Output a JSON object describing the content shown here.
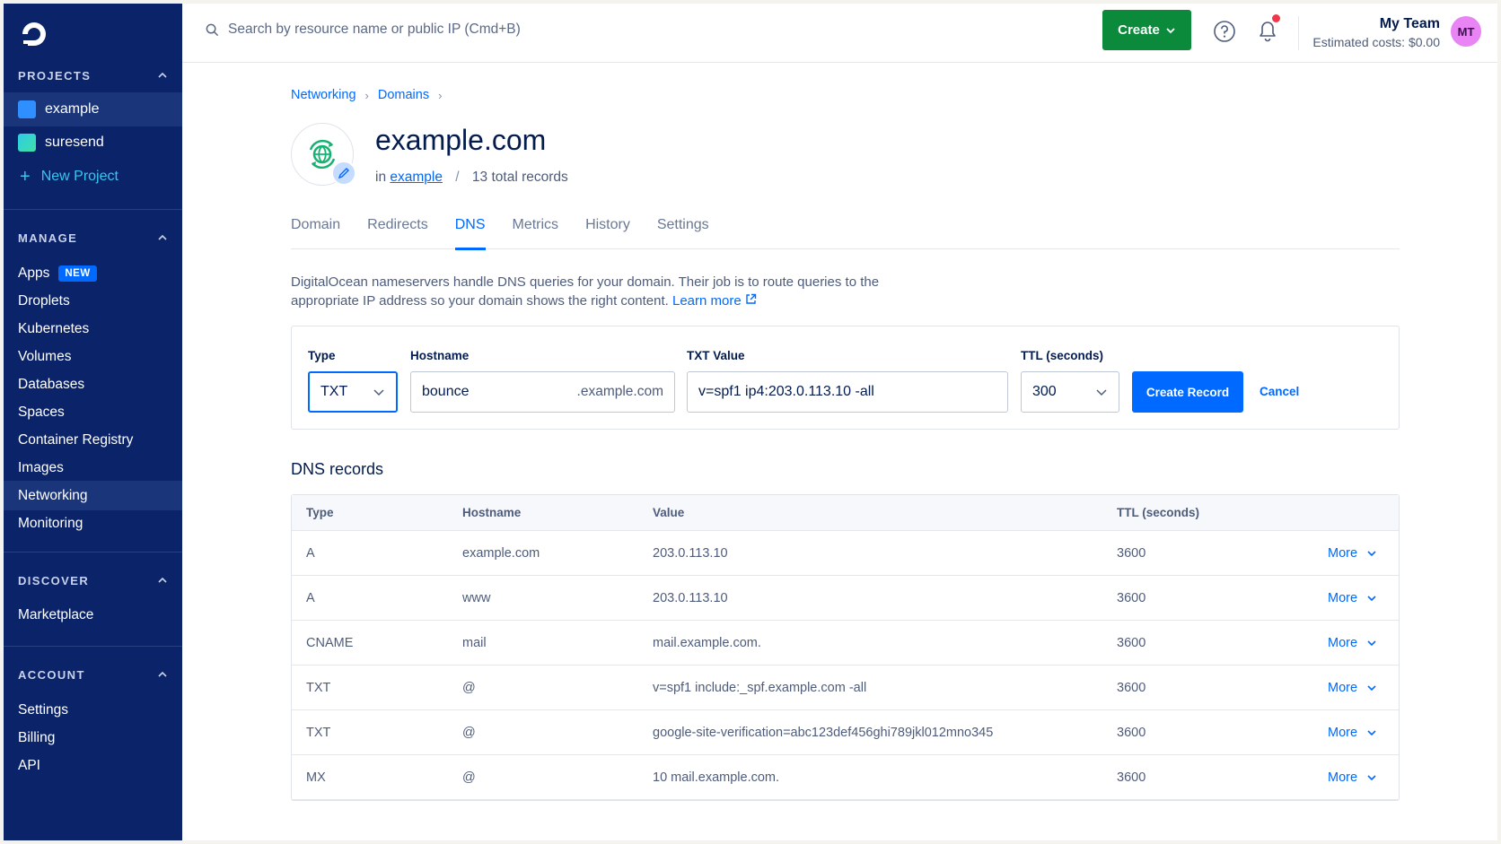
{
  "sidebar": {
    "projects_heading": "PROJECTS",
    "projects": [
      {
        "label": "example",
        "color": "#2f8fff"
      },
      {
        "label": "suresend",
        "color": "#2ecbe6"
      }
    ],
    "new_project": "New Project",
    "manage_heading": "MANAGE",
    "manage_items": [
      "Apps",
      "Droplets",
      "Kubernetes",
      "Volumes",
      "Databases",
      "Spaces",
      "Container Registry",
      "Images",
      "Networking",
      "Monitoring"
    ],
    "apps_badge": "NEW",
    "discover_heading": "DISCOVER",
    "discover_items": [
      "Marketplace"
    ],
    "account_heading": "ACCOUNT",
    "account_items": [
      "Settings",
      "Billing",
      "API"
    ],
    "active_item": "Networking"
  },
  "topbar": {
    "search_placeholder": "Search by resource name or public IP (Cmd+B)",
    "create_label": "Create",
    "team_name": "My Team",
    "estimated_costs": "Estimated costs: $0.00",
    "avatar_initials": "MT",
    "notification_dot_color": "#f0384a"
  },
  "breadcrumb": [
    "Networking",
    "Domains"
  ],
  "domain": {
    "title": "example.com",
    "in_label": "in",
    "project_link": "example",
    "records_count": "13 total records"
  },
  "tabs": [
    "Domain",
    "Redirects",
    "DNS",
    "Metrics",
    "History",
    "Settings"
  ],
  "active_tab": "DNS",
  "description": {
    "line1": "DigitalOcean nameservers handle DNS queries for your domain. Their job is to route queries to the",
    "line2": "appropriate IP address so your domain shows the right content.",
    "learn_more": "Learn more"
  },
  "form": {
    "type_label": "Type",
    "type_value": "TXT",
    "hostname_label": "Hostname",
    "hostname_value": "bounce",
    "hostname_suffix": ".example.com",
    "value_label": "TXT Value",
    "value_value": "v=spf1 ip4:203.0.113.10 -all",
    "ttl_label": "TTL (seconds)",
    "ttl_value": "300",
    "create_record": "Create Record",
    "cancel": "Cancel"
  },
  "records": {
    "title": "DNS records",
    "columns": [
      "Type",
      "Hostname",
      "Value",
      "TTL (seconds)"
    ],
    "more_label": "More",
    "rows": [
      {
        "type": "A",
        "hostname": "example.com",
        "value": "203.0.113.10",
        "ttl": "3600"
      },
      {
        "type": "A",
        "hostname": "www",
        "value": "203.0.113.10",
        "ttl": "3600"
      },
      {
        "type": "CNAME",
        "hostname": "mail",
        "value": "mail.example.com.",
        "ttl": "3600"
      },
      {
        "type": "TXT",
        "hostname": "@",
        "value": "v=spf1 include:_spf.example.com -all",
        "ttl": "3600"
      },
      {
        "type": "TXT",
        "hostname": "@",
        "value": "google-site-verification=abc123def456ghi789jkl012mno345",
        "ttl": "3600"
      },
      {
        "type": "MX",
        "hostname": "@",
        "value": "10 mail.example.com.",
        "ttl": "3600"
      }
    ]
  }
}
